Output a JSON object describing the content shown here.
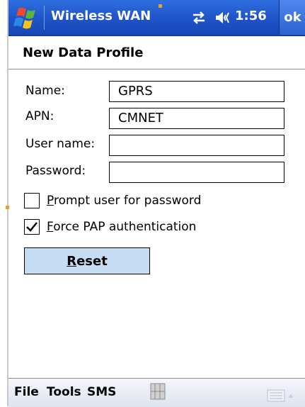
{
  "titlebar": {
    "app_title": "Wireless WAN",
    "time": "1:56",
    "ok_label": "ok",
    "icons": [
      "windows-start-icon",
      "connectivity-icon",
      "volume-icon"
    ]
  },
  "header": {
    "title": "New Data Profile"
  },
  "form": {
    "name": {
      "label": "Name:",
      "value": "GPRS"
    },
    "apn": {
      "label": "APN:",
      "value": "CMNET"
    },
    "username": {
      "label": "User name:",
      "value": ""
    },
    "password": {
      "label": "Password:",
      "value": ""
    },
    "prompt": {
      "underline": "P",
      "rest": "rompt user for password",
      "checked": false
    },
    "pap": {
      "underline": "F",
      "rest": "orce PAP authentication",
      "checked": true
    },
    "reset": {
      "underline": "R",
      "rest": "eset"
    }
  },
  "menubar": {
    "file": "File",
    "tools": "Tools",
    "sms": "SMS",
    "icons": [
      "input-panel-icon",
      "keyboard-icon"
    ]
  },
  "colors": {
    "titlebar": "#1f55c9",
    "reset_button": "#c6dcf2",
    "menubar": "#dde3ee"
  }
}
